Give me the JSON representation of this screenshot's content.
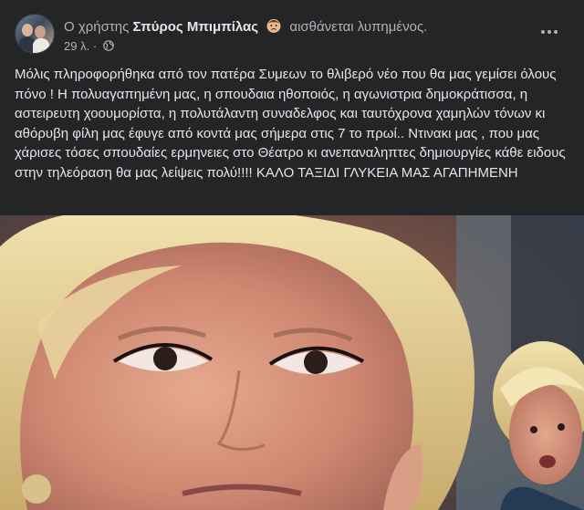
{
  "post": {
    "prefix": "Ο χρήστης",
    "author": "Σπύρος Μπιμπίλας",
    "feeling": "αισθάνεται λυπημένος.",
    "feeling_icon": "sad-face-emoji-icon",
    "time": "29 λ.",
    "separator": "·",
    "privacy_icon": "globe-icon",
    "more_icon": "more-options-icon",
    "text": "Μόλις πληροφορήθηκα από τον πατέρα Συμεων το θλιβερό νέο που θα μας γεμίσει όλους πόνο ! Η πολυαγαπημένη μας, η σπουδαια ηθοποιός, η αγωνιστρια δημοκράτισσα, η αστειρευτη χοουμορίστα, η πολυτάλαντη συναδελφος και ταυτόχρονα χαμηλών τόνων κι αθόρυβη φίλη μας έφυγε από κοντά μας σήμερα στις 7 το πρωί.. Ντινακι μας , που μας χάρισες τόσες σπουδαίες ερμηνειες στο Θέατρο κι ανεπαναληπτες  δημιουργίες κάθε ειδους στην τηλεόραση θα μας λείψεις πολύ!!!! ΚΑΛΟ ΤΑΞΙΔΙ ΓΛΥΚΕΙΑ ΜΑΣ ΑΓΑΠΗΜΕΝΗ"
  },
  "colors": {
    "card_bg": "#242526",
    "text_primary": "#e4e6eb",
    "text_secondary": "#b0b3b8"
  }
}
